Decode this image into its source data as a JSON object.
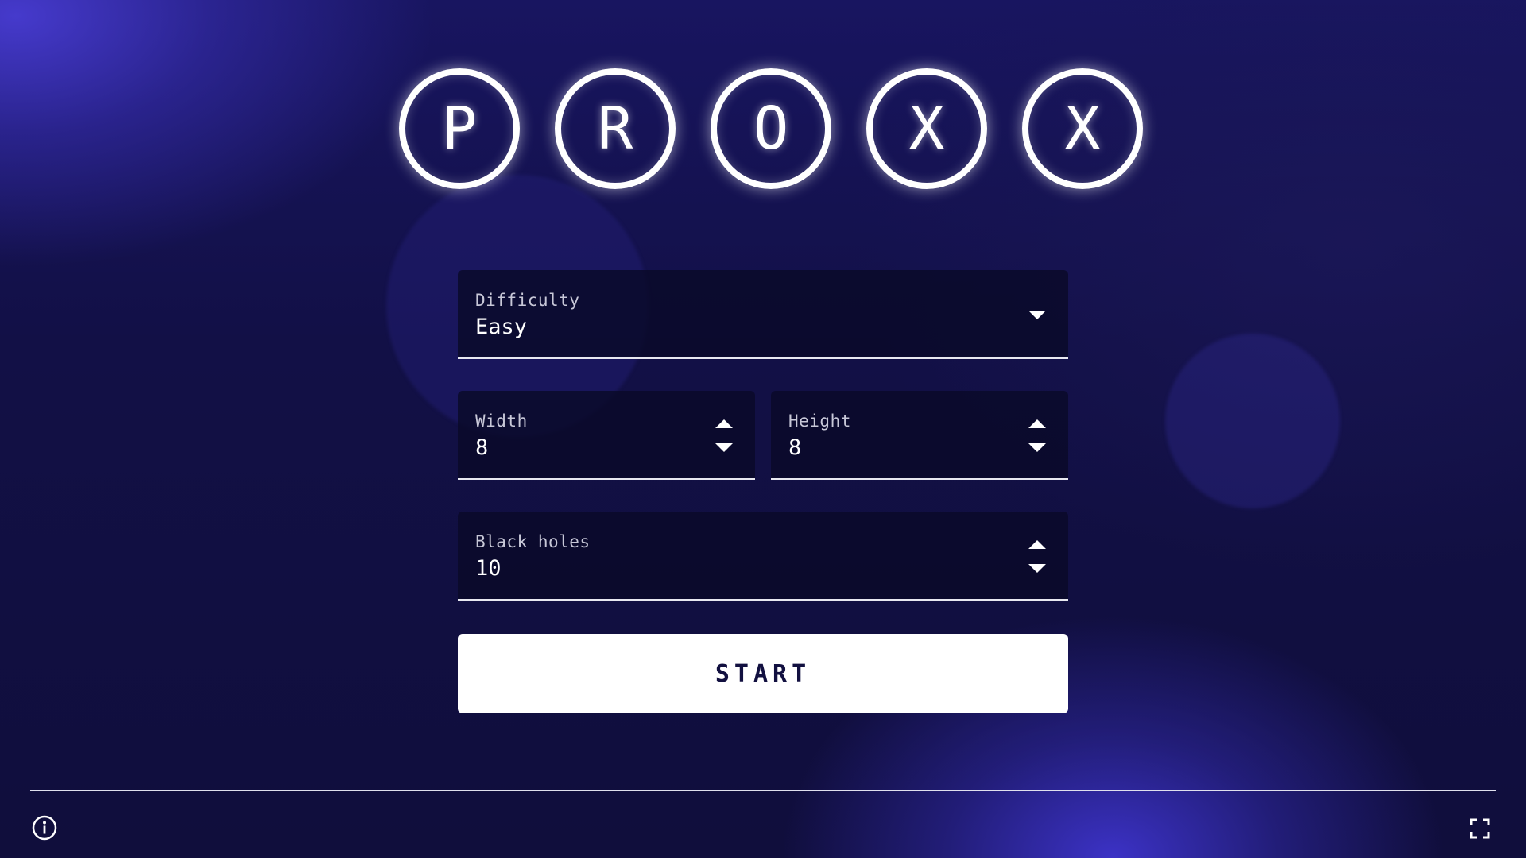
{
  "logo": {
    "letters": [
      "P",
      "R",
      "O",
      "X",
      "X"
    ]
  },
  "form": {
    "difficulty": {
      "label": "Difficulty",
      "value": "Easy"
    },
    "width": {
      "label": "Width",
      "value": "8"
    },
    "height": {
      "label": "Height",
      "value": "8"
    },
    "black_holes": {
      "label": "Black holes",
      "value": "10"
    }
  },
  "start_button": {
    "label": "START"
  },
  "footer": {
    "left_icon": "info-icon",
    "right_icon": "fullscreen-icon"
  },
  "colors": {
    "background": "#121040",
    "accent": "#3a30c8",
    "field_bg": "#0a0a28",
    "text": "#ffffff",
    "button_text": "#121040"
  }
}
